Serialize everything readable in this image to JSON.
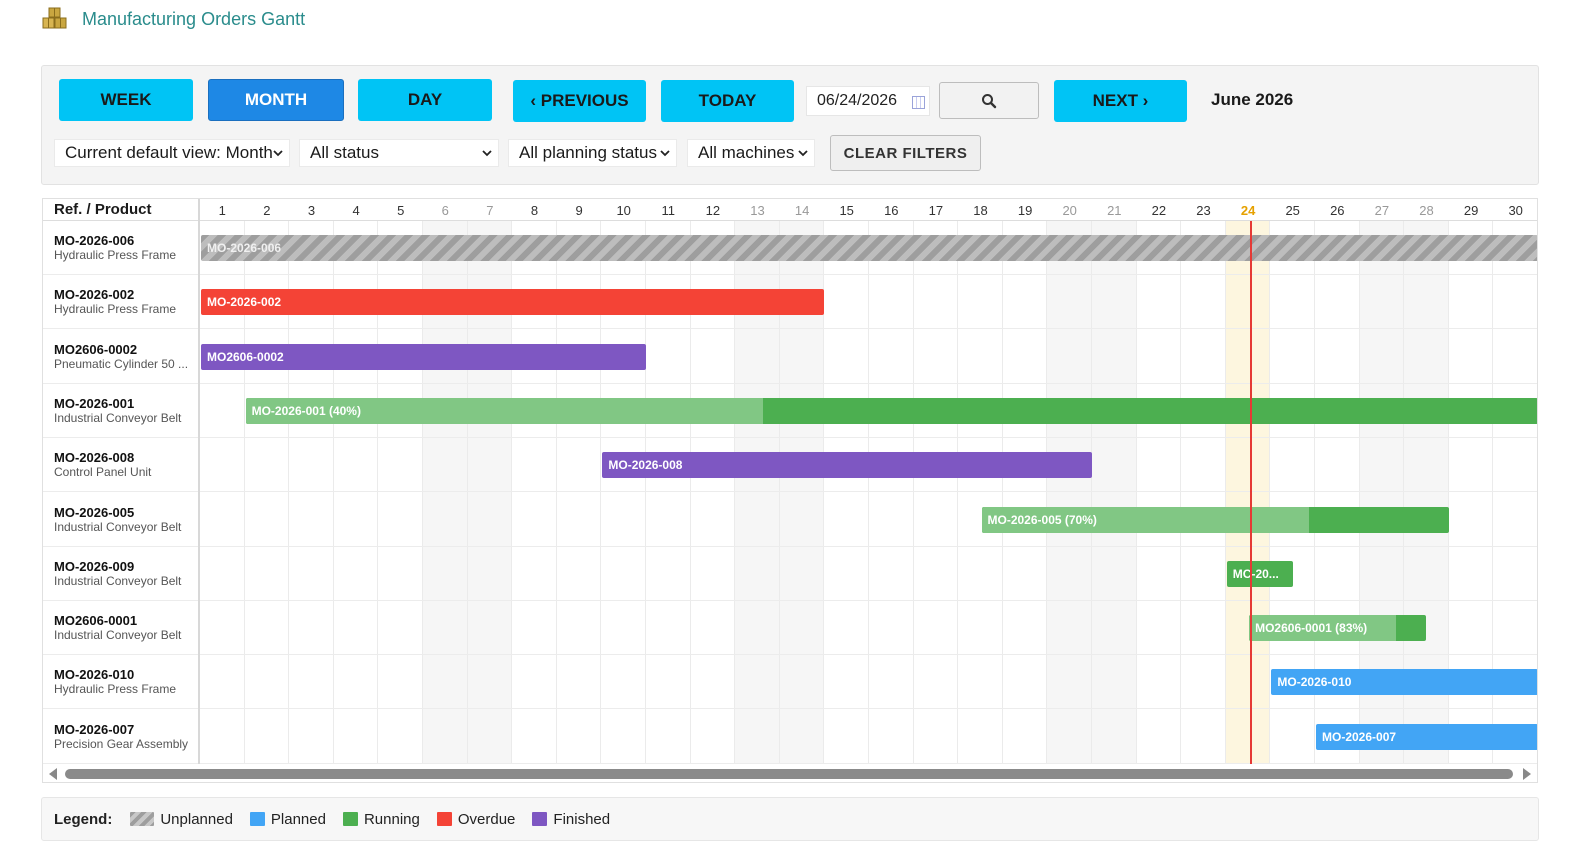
{
  "title": "Manufacturing Orders Gantt",
  "toolbar": {
    "week": "WEEK",
    "month": "MONTH",
    "day": "DAY",
    "previous": "‹ PREVIOUS",
    "today": "TODAY",
    "date_value": "06/24/2026",
    "next": "NEXT ›",
    "period": "June 2026"
  },
  "filters": {
    "default_view": "Current default view: Month",
    "status": "All status",
    "planning_status": "All planning status",
    "machines": "All machines",
    "clear": "CLEAR FILTERS"
  },
  "gantt": {
    "header": "Ref. / Product",
    "days": [
      "1",
      "2",
      "3",
      "4",
      "5",
      "6",
      "7",
      "8",
      "9",
      "10",
      "11",
      "12",
      "13",
      "14",
      "15",
      "16",
      "17",
      "18",
      "19",
      "20",
      "21",
      "22",
      "23",
      "24",
      "25",
      "26",
      "27",
      "28",
      "29",
      "30"
    ],
    "weekend_days": [
      6,
      7,
      13,
      14,
      20,
      21,
      27,
      28
    ],
    "today_day": 24,
    "rows": [
      {
        "ref": "MO-2026-006",
        "product": "Hydraulic Press Frame",
        "bar": {
          "label": "MO-2026-006",
          "status": "unplanned",
          "start": 1,
          "end": 31,
          "progress": null
        }
      },
      {
        "ref": "MO-2026-002",
        "product": "Hydraulic Press Frame",
        "bar": {
          "label": "MO-2026-002",
          "status": "overdue",
          "start": 1,
          "end": 15,
          "progress": null
        }
      },
      {
        "ref": "MO2606-0002",
        "product": "Pneumatic Cylinder 50 ...",
        "bar": {
          "label": "MO2606-0002",
          "status": "finished",
          "start": 1,
          "end": 11,
          "progress": null
        }
      },
      {
        "ref": "MO-2026-001",
        "product": "Industrial Conveyor Belt",
        "bar": {
          "label": "MO-2026-001 (40%)",
          "status": "running",
          "start": 2,
          "end": 31,
          "progress": 40
        }
      },
      {
        "ref": "MO-2026-008",
        "product": "Control Panel Unit",
        "bar": {
          "label": "MO-2026-008",
          "status": "finished",
          "start": 10,
          "end": 21,
          "progress": null
        }
      },
      {
        "ref": "MO-2026-005",
        "product": "Industrial Conveyor Belt",
        "bar": {
          "label": "MO-2026-005 (70%)",
          "status": "running",
          "start": 18.5,
          "end": 29,
          "progress": 70
        }
      },
      {
        "ref": "MO-2026-009",
        "product": "Industrial Conveyor Belt",
        "bar": {
          "label": "MC-20...",
          "status": "running",
          "start": 24,
          "end": 25.5,
          "progress": null
        }
      },
      {
        "ref": "MO2606-0001",
        "product": "Industrial Conveyor Belt",
        "bar": {
          "label": "MO2606-0001 (83%)",
          "status": "running",
          "start": 24.5,
          "end": 28.5,
          "progress": 83
        }
      },
      {
        "ref": "MO-2026-010",
        "product": "Hydraulic Press Frame",
        "bar": {
          "label": "MO-2026-010",
          "status": "planned",
          "start": 25,
          "end": 31,
          "progress": null
        }
      },
      {
        "ref": "MO-2026-007",
        "product": "Precision Gear Assembly",
        "bar": {
          "label": "MO-2026-007",
          "status": "planned",
          "start": 26,
          "end": 31,
          "progress": null
        }
      }
    ]
  },
  "legend": {
    "title": "Legend:",
    "items": [
      {
        "label": "Unplanned",
        "key": "unplanned",
        "color": "#9e9e9e"
      },
      {
        "label": "Planned",
        "key": "planned",
        "color": "#42a5f5"
      },
      {
        "label": "Running",
        "key": "running",
        "color": "#4caf50"
      },
      {
        "label": "Overdue",
        "key": "overdue",
        "color": "#f44336"
      },
      {
        "label": "Finished",
        "key": "finished",
        "color": "#7e57c2"
      }
    ]
  },
  "icons": {
    "title": "boxes-icon",
    "search": "search-icon",
    "calendar": "calendar-icon",
    "dropdown": "chevron-down-icon"
  }
}
